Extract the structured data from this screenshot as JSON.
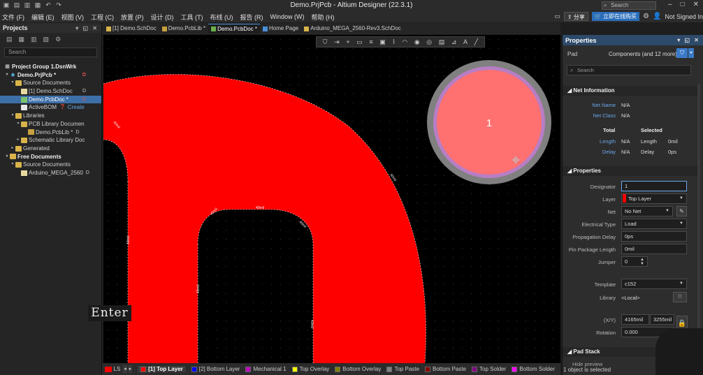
{
  "titlebar": {
    "title": "Demo.PrjPcb - Altium Designer (22.3.1)",
    "search_placeholder": "Search",
    "icons": [
      "app-icon",
      "save-icon",
      "save-all-icon",
      "open-icon",
      "undo-icon",
      "redo-icon"
    ]
  },
  "menubar": {
    "items": [
      "文件 (F)",
      "编辑 (E)",
      "视图 (V)",
      "工程 (C)",
      "放置 (P)",
      "设计 (D)",
      "工具 (T)",
      "布线 (U)",
      "报告 (R)",
      "Window (W)",
      "帮助 (H)"
    ],
    "share_label": "分享",
    "buy_label": "立即在线购买",
    "not_signed": "Not Signed In"
  },
  "projects": {
    "title": "Projects",
    "search_placeholder": "Search",
    "tree": [
      {
        "label": "Project Group 1.DsnWrk",
        "level": 0,
        "icon": "workspace",
        "bold": true
      },
      {
        "label": "Demo.PrjPcb *",
        "level": 1,
        "icon": "pcb-project",
        "bold": true,
        "badge": "D"
      },
      {
        "label": "Source Documents",
        "level": 2,
        "icon": "folder"
      },
      {
        "label": "[1] Demo.SchDoc",
        "level": 3,
        "icon": "sch",
        "badge_d": "D"
      },
      {
        "label": "Demo.PcbDoc *",
        "level": 3,
        "icon": "pcb",
        "selected": true,
        "badge": "D"
      },
      {
        "label": "ActiveBOM",
        "level": 3,
        "icon": "bom",
        "link": "Create"
      },
      {
        "label": "Libraries",
        "level": 2,
        "icon": "folder"
      },
      {
        "label": "PCB Library Documen",
        "level": 3,
        "icon": "folder"
      },
      {
        "label": "Demo.PcbLib *",
        "level": 4,
        "icon": "pcblib",
        "badge_d": "D"
      },
      {
        "label": "Schematic Library Doc",
        "level": 3,
        "icon": "folder"
      },
      {
        "label": "Generated",
        "level": 2,
        "icon": "folder"
      },
      {
        "label": "Free Documents",
        "level": 1,
        "icon": "folder",
        "bold": true
      },
      {
        "label": "Source Documents",
        "level": 2,
        "icon": "folder"
      },
      {
        "label": "Arduino_MEGA_2560",
        "level": 3,
        "icon": "sch",
        "badge_d": "D"
      }
    ]
  },
  "tabs": [
    {
      "label": "[1] Demo.SchDoc",
      "color": "#d9b44a"
    },
    {
      "label": "Demo.PcbLib *",
      "color": "#c8a040"
    },
    {
      "label": "Demo.PcbDoc *",
      "color": "#6ab04c",
      "active": true
    },
    {
      "label": "Home Page",
      "color": "#4a90d9"
    },
    {
      "label": "Arduino_MEGA_2560-Rev3.SchDoc",
      "color": "#d9b44a"
    }
  ],
  "canvas": {
    "pad_number": "1",
    "tooltip": "Enter",
    "dims": [
      "40mil",
      "40mil",
      "40mil",
      "40mil",
      "40mil",
      "40mil",
      "40mil",
      "40mil"
    ],
    "colors": {
      "copper": "#ff0000",
      "pad_face": "#ff7070",
      "solder_ring": "#b87ec4",
      "pad_rim": "#808080",
      "cursor": "#c0c0c0"
    }
  },
  "layerbar": {
    "ls_label": "LS",
    "layers": [
      {
        "label": "[1] Top Layer",
        "color": "#ff0000",
        "active": true
      },
      {
        "label": "[2] Bottom Layer",
        "color": "#0000ff"
      },
      {
        "label": "Mechanical 1",
        "color": "#c000c0"
      },
      {
        "label": "Top Overlay",
        "color": "#ffff00"
      },
      {
        "label": "Bottom Overlay",
        "color": "#808000"
      },
      {
        "label": "Top Paste",
        "color": "#808080"
      },
      {
        "label": "Bottom Paste",
        "color": "#800000"
      },
      {
        "label": "Top Solder",
        "color": "#800080"
      },
      {
        "label": "Bottom Solder",
        "color": "#ff00ff"
      }
    ],
    "status": "1 object is selected"
  },
  "properties": {
    "title": "Properties",
    "kind": "Pad",
    "filter_text": "Components (and 12 more)",
    "search_placeholder": "Search",
    "net_info": {
      "title": "Net Information",
      "net_name_label": "Net Name",
      "net_name": "N/A",
      "net_class_label": "Net Class",
      "net_class": "N/A",
      "total_hdr": "Total",
      "selected_hdr": "Selected",
      "length_label": "Length",
      "length_total": "N/A",
      "length_sel_label": "Length",
      "length_sel": "0mil",
      "delay_label": "Delay",
      "delay_total": "N/A",
      "delay_sel_label": "Delay",
      "delay_sel": "0ps"
    },
    "props": {
      "title": "Properties",
      "designator_label": "Designator",
      "designator": "1",
      "layer_label": "Layer",
      "layer": "Top Layer",
      "net_label": "Net",
      "net": "No Net",
      "etype_label": "Electrical Type",
      "etype": "Load",
      "prop_delay_label": "Propagation Delay",
      "prop_delay": "0ps",
      "pin_len_label": "Pin Package Length",
      "pin_len": "0mil",
      "jumper_label": "Jumper",
      "jumper": "0",
      "template_label": "Template",
      "template": "c152",
      "library_label": "Library",
      "library": "<Local>",
      "xy_label": "(X/Y)",
      "x": "4165mil",
      "y": "3255mil",
      "rotation_label": "Rotation",
      "rotation": "0.000"
    },
    "padstack_title": "Pad Stack",
    "hide_preview": "Hide preview"
  }
}
